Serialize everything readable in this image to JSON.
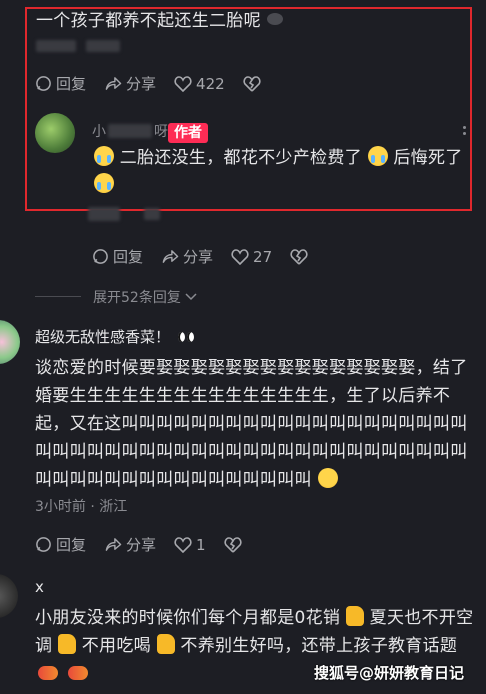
{
  "comment1": {
    "text": "一个孩子都养不起还生二胎呢",
    "reply_label": "回复",
    "share_label": "分享",
    "likes": "422"
  },
  "reply1": {
    "username": "小",
    "username_tail": "呀",
    "author_badge": "作者",
    "text_a": "二胎还没生，都花不少产检费了",
    "text_b": "后悔死了",
    "reply_label": "回复",
    "share_label": "分享",
    "likes": "27"
  },
  "expand": {
    "label": "展开52条回复"
  },
  "comment2": {
    "username": "超级无敌性感香菜！",
    "text": "谈恋爱的时候要娶娶娶娶娶娶娶娶娶娶娶娶娶娶娶，结了婚要生生生生生生生生生生生生生生生，生了以后养不起，又在这叫叫叫叫叫叫叫叫叫叫叫叫叫叫叫叫叫叫叫叫叫叫叫叫叫叫叫叫叫叫叫叫叫叫叫叫叫叫叫叫叫叫叫叫叫叫叫叫叫叫叫叫叫叫叫叫叫叫叫叫叫",
    "meta": "3小时前 · 浙江",
    "reply_label": "回复",
    "share_label": "分享",
    "likes": "1"
  },
  "comment3": {
    "username": "x",
    "text_a": "小朋友没来的时候你们每个月都是0花销",
    "text_b": "夏天也不开空调",
    "text_c": "不用吃喝",
    "text_d": "不养别生好吗，还带上孩子教育话题"
  },
  "watermark": "搜狐号@妍妍教育日记",
  "colors": {
    "accent": "#fe2c55",
    "frame": "#e0282d",
    "background": "#1d1e24"
  }
}
